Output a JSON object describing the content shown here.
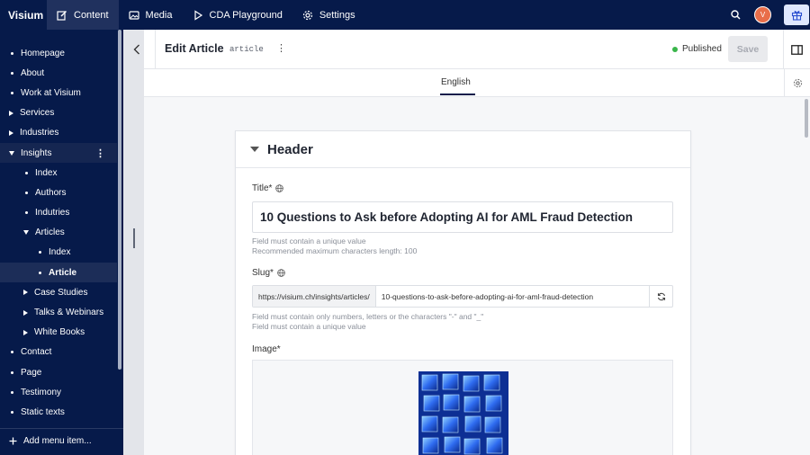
{
  "app": {
    "brand": "Visium",
    "nav": [
      {
        "label": "Content",
        "icon": "edit-icon",
        "active": true
      },
      {
        "label": "Media",
        "icon": "image-icon",
        "active": false
      },
      {
        "label": "CDA Playground",
        "icon": "play-icon",
        "active": false
      },
      {
        "label": "Settings",
        "icon": "gear-icon",
        "active": false
      }
    ],
    "avatar_initial": "V",
    "colors": {
      "topbar": "#061a4a",
      "avatar": "#e86e4a",
      "published": "#39b54a"
    }
  },
  "sidebar": {
    "items": [
      {
        "label": "Homepage",
        "marker": "bullet",
        "level": 0
      },
      {
        "label": "About",
        "marker": "bullet",
        "level": 0
      },
      {
        "label": "Work at Visium",
        "marker": "bullet",
        "level": 0
      },
      {
        "label": "Services",
        "marker": "caret-right",
        "level": 0
      },
      {
        "label": "Industries",
        "marker": "caret-right",
        "level": 0
      },
      {
        "label": "Insights",
        "marker": "caret-down",
        "level": 0,
        "highlight": true
      },
      {
        "label": "Index",
        "marker": "bullet",
        "level": 1
      },
      {
        "label": "Authors",
        "marker": "bullet",
        "level": 1
      },
      {
        "label": "Indutries",
        "marker": "bullet",
        "level": 1
      },
      {
        "label": "Articles",
        "marker": "caret-down",
        "level": 1
      },
      {
        "label": "Index",
        "marker": "bullet",
        "level": 2
      },
      {
        "label": "Article",
        "marker": "bullet",
        "level": 2,
        "selected": true
      },
      {
        "label": "Case Studies",
        "marker": "caret-right",
        "level": 1
      },
      {
        "label": "Talks & Webinars",
        "marker": "caret-right",
        "level": 1
      },
      {
        "label": "White Books",
        "marker": "caret-right",
        "level": 1
      },
      {
        "label": "Contact",
        "marker": "bullet",
        "level": 0
      },
      {
        "label": "Page",
        "marker": "bullet",
        "level": 0
      },
      {
        "label": "Testimony",
        "marker": "bullet",
        "level": 0
      },
      {
        "label": "Static texts",
        "marker": "bullet",
        "level": 0
      }
    ],
    "add_menu_label": "Add menu item..."
  },
  "editor": {
    "title": "Edit Article",
    "content_type": "article",
    "status": "Published",
    "save_label": "Save",
    "language_tab": "English"
  },
  "form": {
    "section_title": "Header",
    "title_label": "Title*",
    "title_value": "10 Questions to Ask before Adopting AI for AML Fraud Detection",
    "title_hint_1": "Field must contain a unique value",
    "title_hint_2": "Recommended maximum characters length: 100",
    "slug_label": "Slug*",
    "slug_prefix": "https://visium.ch/insights/articles/",
    "slug_value": "10-questions-to-ask-before-adopting-ai-for-aml-fraud-detection",
    "slug_hint_1": "Field must contain only numbers, letters or the characters \"-\" and \"_\"",
    "slug_hint_2": "Field must contain a unique value",
    "image_label": "Image*"
  }
}
